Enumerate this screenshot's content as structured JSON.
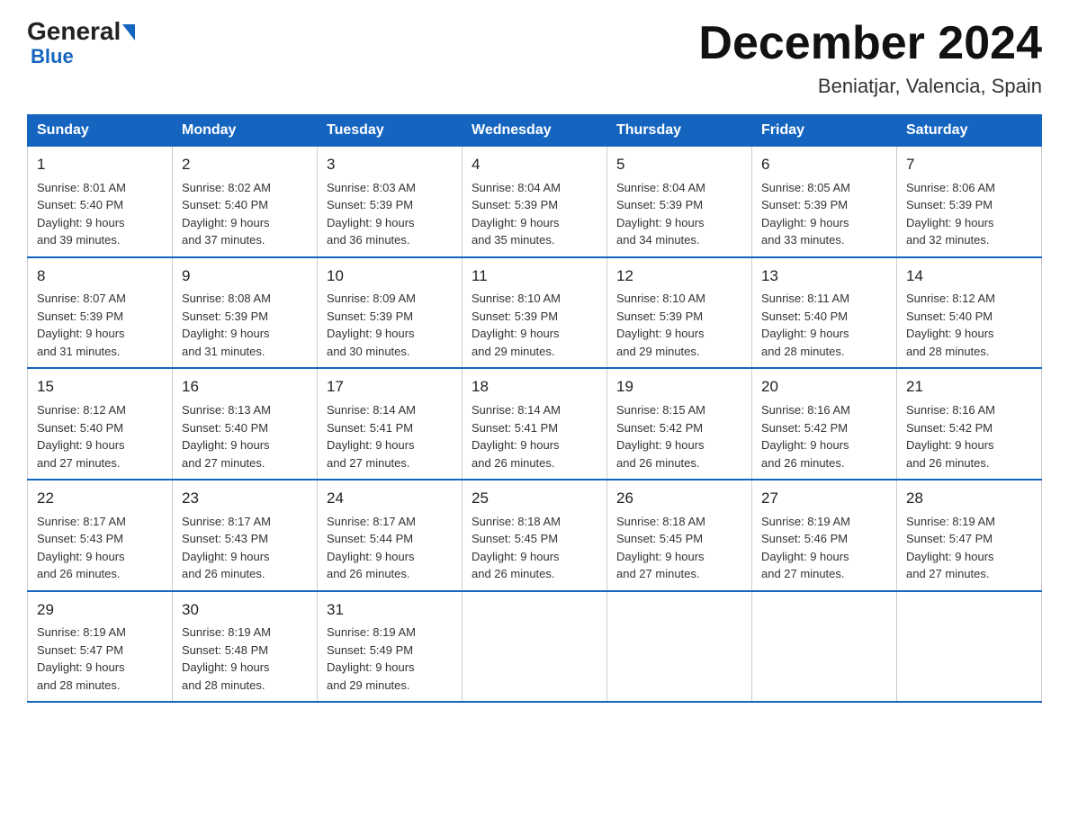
{
  "logo": {
    "general": "General",
    "blue": "Blue",
    "arrow_unicode": "▶"
  },
  "title": {
    "month_year": "December 2024",
    "location": "Beniatjar, Valencia, Spain"
  },
  "days_of_week": [
    "Sunday",
    "Monday",
    "Tuesday",
    "Wednesday",
    "Thursday",
    "Friday",
    "Saturday"
  ],
  "weeks": [
    [
      {
        "day": "1",
        "sunrise": "8:01 AM",
        "sunset": "5:40 PM",
        "daylight": "9 hours and 39 minutes."
      },
      {
        "day": "2",
        "sunrise": "8:02 AM",
        "sunset": "5:40 PM",
        "daylight": "9 hours and 37 minutes."
      },
      {
        "day": "3",
        "sunrise": "8:03 AM",
        "sunset": "5:39 PM",
        "daylight": "9 hours and 36 minutes."
      },
      {
        "day": "4",
        "sunrise": "8:04 AM",
        "sunset": "5:39 PM",
        "daylight": "9 hours and 35 minutes."
      },
      {
        "day": "5",
        "sunrise": "8:04 AM",
        "sunset": "5:39 PM",
        "daylight": "9 hours and 34 minutes."
      },
      {
        "day": "6",
        "sunrise": "8:05 AM",
        "sunset": "5:39 PM",
        "daylight": "9 hours and 33 minutes."
      },
      {
        "day": "7",
        "sunrise": "8:06 AM",
        "sunset": "5:39 PM",
        "daylight": "9 hours and 32 minutes."
      }
    ],
    [
      {
        "day": "8",
        "sunrise": "8:07 AM",
        "sunset": "5:39 PM",
        "daylight": "9 hours and 31 minutes."
      },
      {
        "day": "9",
        "sunrise": "8:08 AM",
        "sunset": "5:39 PM",
        "daylight": "9 hours and 31 minutes."
      },
      {
        "day": "10",
        "sunrise": "8:09 AM",
        "sunset": "5:39 PM",
        "daylight": "9 hours and 30 minutes."
      },
      {
        "day": "11",
        "sunrise": "8:10 AM",
        "sunset": "5:39 PM",
        "daylight": "9 hours and 29 minutes."
      },
      {
        "day": "12",
        "sunrise": "8:10 AM",
        "sunset": "5:39 PM",
        "daylight": "9 hours and 29 minutes."
      },
      {
        "day": "13",
        "sunrise": "8:11 AM",
        "sunset": "5:40 PM",
        "daylight": "9 hours and 28 minutes."
      },
      {
        "day": "14",
        "sunrise": "8:12 AM",
        "sunset": "5:40 PM",
        "daylight": "9 hours and 28 minutes."
      }
    ],
    [
      {
        "day": "15",
        "sunrise": "8:12 AM",
        "sunset": "5:40 PM",
        "daylight": "9 hours and 27 minutes."
      },
      {
        "day": "16",
        "sunrise": "8:13 AM",
        "sunset": "5:40 PM",
        "daylight": "9 hours and 27 minutes."
      },
      {
        "day": "17",
        "sunrise": "8:14 AM",
        "sunset": "5:41 PM",
        "daylight": "9 hours and 27 minutes."
      },
      {
        "day": "18",
        "sunrise": "8:14 AM",
        "sunset": "5:41 PM",
        "daylight": "9 hours and 26 minutes."
      },
      {
        "day": "19",
        "sunrise": "8:15 AM",
        "sunset": "5:42 PM",
        "daylight": "9 hours and 26 minutes."
      },
      {
        "day": "20",
        "sunrise": "8:16 AM",
        "sunset": "5:42 PM",
        "daylight": "9 hours and 26 minutes."
      },
      {
        "day": "21",
        "sunrise": "8:16 AM",
        "sunset": "5:42 PM",
        "daylight": "9 hours and 26 minutes."
      }
    ],
    [
      {
        "day": "22",
        "sunrise": "8:17 AM",
        "sunset": "5:43 PM",
        "daylight": "9 hours and 26 minutes."
      },
      {
        "day": "23",
        "sunrise": "8:17 AM",
        "sunset": "5:43 PM",
        "daylight": "9 hours and 26 minutes."
      },
      {
        "day": "24",
        "sunrise": "8:17 AM",
        "sunset": "5:44 PM",
        "daylight": "9 hours and 26 minutes."
      },
      {
        "day": "25",
        "sunrise": "8:18 AM",
        "sunset": "5:45 PM",
        "daylight": "9 hours and 26 minutes."
      },
      {
        "day": "26",
        "sunrise": "8:18 AM",
        "sunset": "5:45 PM",
        "daylight": "9 hours and 27 minutes."
      },
      {
        "day": "27",
        "sunrise": "8:19 AM",
        "sunset": "5:46 PM",
        "daylight": "9 hours and 27 minutes."
      },
      {
        "day": "28",
        "sunrise": "8:19 AM",
        "sunset": "5:47 PM",
        "daylight": "9 hours and 27 minutes."
      }
    ],
    [
      {
        "day": "29",
        "sunrise": "8:19 AM",
        "sunset": "5:47 PM",
        "daylight": "9 hours and 28 minutes."
      },
      {
        "day": "30",
        "sunrise": "8:19 AM",
        "sunset": "5:48 PM",
        "daylight": "9 hours and 28 minutes."
      },
      {
        "day": "31",
        "sunrise": "8:19 AM",
        "sunset": "5:49 PM",
        "daylight": "9 hours and 29 minutes."
      },
      null,
      null,
      null,
      null
    ]
  ],
  "labels": {
    "sunrise": "Sunrise:",
    "sunset": "Sunset:",
    "daylight": "Daylight:"
  }
}
